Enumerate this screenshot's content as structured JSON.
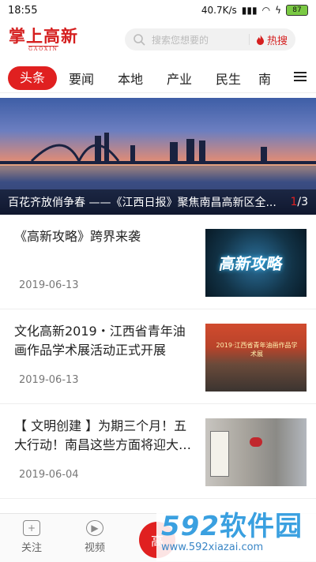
{
  "status_bar": {
    "time": "18:55",
    "network_speed": "40.7K/s",
    "battery": "87"
  },
  "header": {
    "logo_text": "掌上高新",
    "logo_subtext": "GAOXIN",
    "search_placeholder": "搜索您想要的",
    "hot_search_label": "热搜"
  },
  "tabs": [
    {
      "label": "头条",
      "active": true
    },
    {
      "label": "要闻",
      "active": false
    },
    {
      "label": "本地",
      "active": false
    },
    {
      "label": "产业",
      "active": false
    },
    {
      "label": "民生",
      "active": false
    },
    {
      "label": "南",
      "active": false
    }
  ],
  "banner": {
    "caption": "百花齐放俏争春 ——《江西日报》聚焦南昌高新区全...",
    "pager_current": "1",
    "pager_total": "/3"
  },
  "news": [
    {
      "title": "《高新攻略》跨界来袭",
      "date": "2019-06-13",
      "thumb_text": "高新攻略"
    },
    {
      "title": "文化高新2019・江西省青年油画作品学术展活动正式开展",
      "date": "2019-06-13",
      "thumb_text": "2019·江西省青年油画作品学术展"
    },
    {
      "title": "【 文明创建 】为期三个月！五大行动！南昌这些方面将迎大变…",
      "date": "2019-06-04",
      "thumb_text": ""
    }
  ],
  "bottom_nav": {
    "follow_label": "关注",
    "video_label": "视频",
    "center_label": "高"
  },
  "watermark": {
    "brand_number": "592",
    "brand_text": "软件园",
    "url": "www.592xiazai.com"
  }
}
